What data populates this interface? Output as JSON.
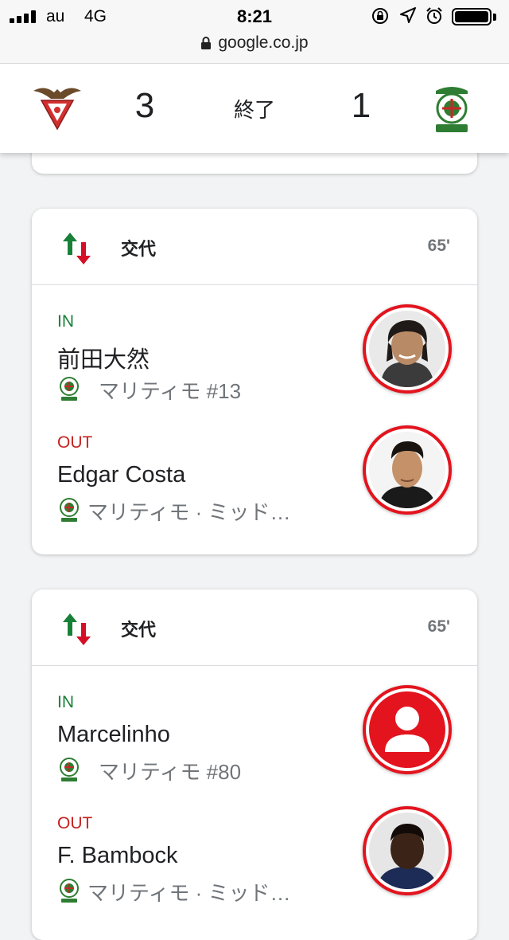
{
  "status_bar": {
    "carrier": "au",
    "network": "4G",
    "time": "8:21"
  },
  "url_bar": {
    "domain": "google.co.jp"
  },
  "match": {
    "home_score": "3",
    "away_score": "1",
    "status": "終了"
  },
  "substitutions": [
    {
      "title": "交代",
      "minute": "65'",
      "in": {
        "label": "IN",
        "name": "前田大然",
        "team": "マリティモ #13"
      },
      "out": {
        "label": "OUT",
        "name": "Edgar Costa",
        "team": "マリティモ · ミッド…"
      }
    },
    {
      "title": "交代",
      "minute": "65'",
      "in": {
        "label": "IN",
        "name": "Marcelinho",
        "team": "マリティモ #80"
      },
      "out": {
        "label": "OUT",
        "name": "F. Bambock",
        "team": "マリティモ · ミッド…"
      }
    }
  ],
  "colors": {
    "in_green": "#188038",
    "out_red": "#c5221f",
    "avatar_ring": "#e3141e"
  }
}
